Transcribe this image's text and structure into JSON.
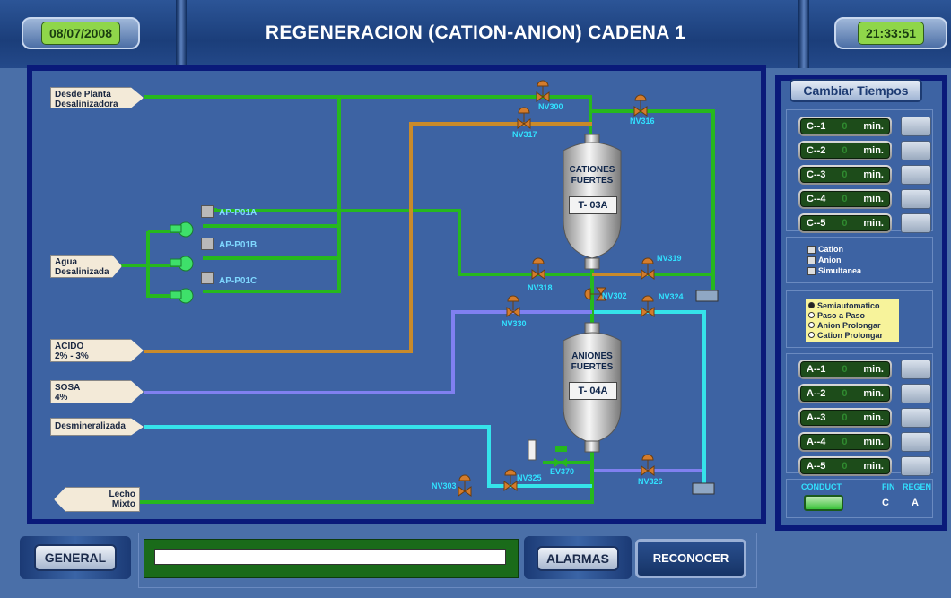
{
  "header": {
    "date": "08/07/2008",
    "title": "REGENERACION (CATION-ANION) CADENA 1",
    "time": "21:33:51"
  },
  "sources": {
    "planta": [
      "Desde Planta",
      "Desalinizadora"
    ],
    "agua": [
      "Agua",
      "Desalinizada"
    ],
    "acido": [
      "ACIDO",
      "2% - 3%"
    ],
    "sosa": [
      "SOSA",
      "4%"
    ],
    "desmin": "Desmineralizada",
    "lecho": [
      "Lecho",
      "Mixto"
    ]
  },
  "pumps": [
    "AP-P01A",
    "AP-P01B",
    "AP-P01C"
  ],
  "valves": {
    "nv300": "NV300",
    "nv316": "NV316",
    "nv317": "NV317",
    "nv318": "NV318",
    "nv319": "NV319",
    "nv302": "NV302",
    "nv324": "NV324",
    "nv330": "NV330",
    "nv303": "NV303",
    "nv325": "NV325",
    "ev370": "EV370",
    "nv326": "NV326"
  },
  "tanks": {
    "cation": {
      "name": [
        "CATIONES",
        "FUERTES"
      ],
      "id": "T- 03A"
    },
    "anion": {
      "name": [
        "ANIONES",
        "FUERTES"
      ],
      "id": "T- 04A"
    }
  },
  "right": {
    "cambiar_label": "Cambiar Tiempos",
    "c_timers": [
      {
        "label": "C--1",
        "value": "0",
        "unit": "min."
      },
      {
        "label": "C--2",
        "value": "0",
        "unit": "min."
      },
      {
        "label": "C--3",
        "value": "0",
        "unit": "min."
      },
      {
        "label": "C--4",
        "value": "0",
        "unit": "min."
      },
      {
        "label": "C--5",
        "value": "0",
        "unit": "min."
      }
    ],
    "checkboxes": [
      "Cation",
      "Anion",
      "Simultanea"
    ],
    "modes": [
      "Semiautomatico",
      "Paso a Paso",
      "Anion Prolongar",
      "Cation Prolongar"
    ],
    "selected_mode": "Semiautomatico",
    "a_timers": [
      {
        "label": "A--1",
        "value": "0",
        "unit": "min."
      },
      {
        "label": "A--2",
        "value": "0",
        "unit": "min."
      },
      {
        "label": "A--3",
        "value": "0",
        "unit": "min."
      },
      {
        "label": "A--4",
        "value": "0",
        "unit": "min."
      },
      {
        "label": "A--5",
        "value": "0",
        "unit": "min."
      }
    ],
    "status": {
      "conduct": "CONDUCT",
      "fin": "FIN",
      "regen": "REGEN",
      "fin_value": "C",
      "regen_value": "A"
    }
  },
  "bottom": {
    "general": "GENERAL",
    "alarmas": "ALARMAS",
    "reconocer": "RECONOCER",
    "message": ""
  },
  "colors": {
    "green_line": "#26b81e",
    "orange_line": "#c98a2a",
    "purple_line": "#8080f0",
    "cyan_line": "#35e3ea",
    "valve": "#d47c2c"
  }
}
